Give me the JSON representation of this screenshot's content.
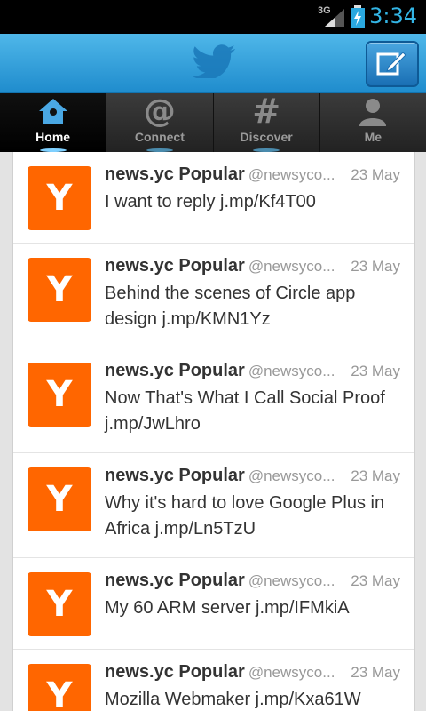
{
  "status_bar": {
    "network": "3G",
    "time": "3:34"
  },
  "header": {
    "logo": "twitter-bird-icon",
    "compose_icon": "compose-icon"
  },
  "tabs": [
    {
      "label": "Home",
      "icon": "home-icon",
      "active": true
    },
    {
      "label": "Connect",
      "icon": "at-icon",
      "active": false
    },
    {
      "label": "Discover",
      "icon": "hash-icon",
      "active": false
    },
    {
      "label": "Me",
      "icon": "person-icon",
      "active": false
    }
  ],
  "tweets": [
    {
      "avatar": "Y",
      "name": "news.yc Popular",
      "handle": "@newsyco...",
      "date": "23 May",
      "text": "I want to reply j.mp/Kf4T00"
    },
    {
      "avatar": "Y",
      "name": "news.yc Popular",
      "handle": "@newsyco...",
      "date": "23 May",
      "text": "Behind the scenes of Circle app design j.mp/KMN1Yz"
    },
    {
      "avatar": "Y",
      "name": "news.yc Popular",
      "handle": "@newsyco...",
      "date": "23 May",
      "text": "Now That's What I Call Social Proof j.mp/JwLhro"
    },
    {
      "avatar": "Y",
      "name": "news.yc Popular",
      "handle": "@newsyco...",
      "date": "23 May",
      "text": "Why it's hard to love Google Plus in Africa j.mp/Ln5TzU"
    },
    {
      "avatar": "Y",
      "name": "news.yc Popular",
      "handle": "@newsyco...",
      "date": "23 May",
      "text": "My 60 ARM server j.mp/IFMkiA"
    },
    {
      "avatar": "Y",
      "name": "news.yc Popular",
      "handle": "@newsyco...",
      "date": "23 May",
      "text": "Mozilla Webmaker j.mp/Kxa61W"
    }
  ],
  "colors": {
    "accent": "#33b5e5",
    "header": "#2a98d8",
    "avatar": "#ff6600"
  }
}
